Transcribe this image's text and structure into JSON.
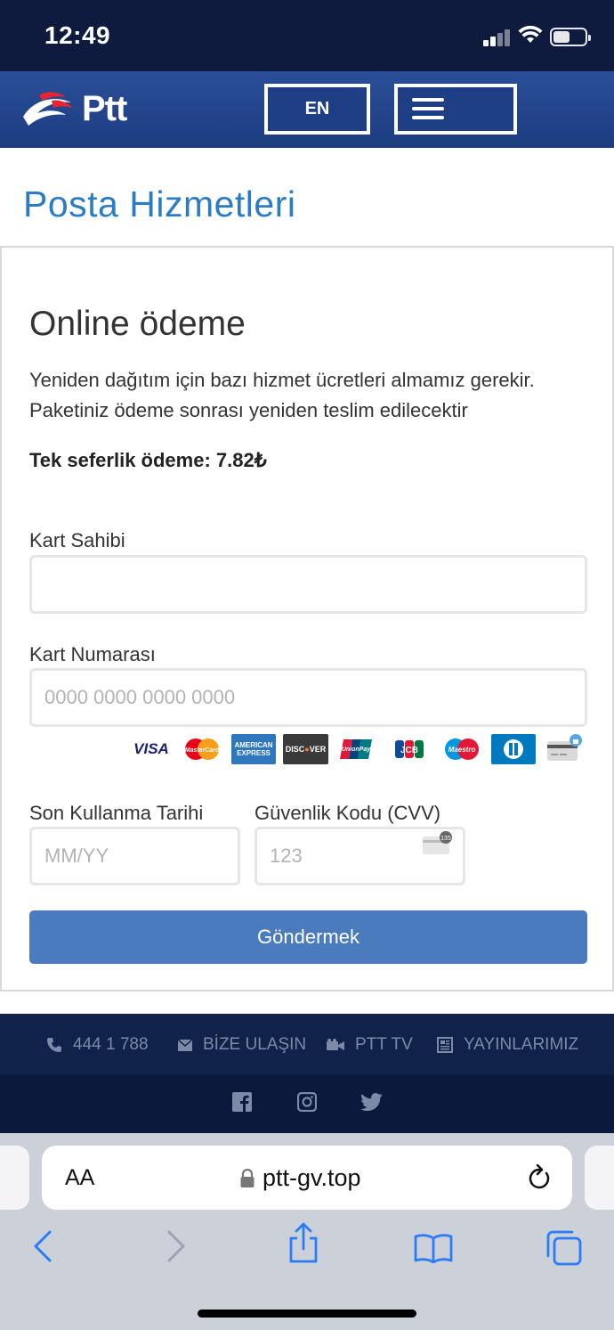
{
  "status": {
    "time": "12:49"
  },
  "header": {
    "logo_text": "Ptt",
    "lang_label": "EN"
  },
  "page": {
    "heading": "Posta Hizmetleri"
  },
  "payment": {
    "title": "Online ödeme",
    "description_line1": "Yeniden dağıtım için bazı hizmet ücretleri almamız gerekir.",
    "description_line2": "Paketiniz ödeme sonrası yeniden teslim edilecektir",
    "amount_text": "Tek seferlik ödeme: 7.82₺",
    "card_holder_label": "Kart Sahibi",
    "card_holder_value": "",
    "card_number_label": "Kart Numarası",
    "card_number_placeholder": "0000 0000 0000 0000",
    "expiry_label": "Son Kullanma Tarihi",
    "expiry_placeholder": "MM/YY",
    "cvv_label": "Güvenlik Kodu (CVV)",
    "cvv_placeholder": "123",
    "submit_label": "Göndermek",
    "card_brands": [
      "VISA",
      "MasterCard",
      "AMERICAN EXPRESS",
      "DISCOVER",
      "UnionPay",
      "JCB",
      "Maestro",
      "Diners Club",
      "Generic card"
    ]
  },
  "footer": {
    "phone": "444 1 788",
    "contact": "BİZE ULAŞIN",
    "tv": "PTT TV",
    "publications": "YAYINLARIMIZ",
    "social": [
      "facebook-icon",
      "instagram-icon",
      "twitter-icon"
    ]
  },
  "browser": {
    "text_size_label": "AA",
    "url": "ptt-gv.top"
  },
  "colors": {
    "header_blue": "#1e3f86",
    "heading_blue": "#2c7cc3",
    "button_blue": "#4a7bbf",
    "footer_navy": "#10214a"
  }
}
